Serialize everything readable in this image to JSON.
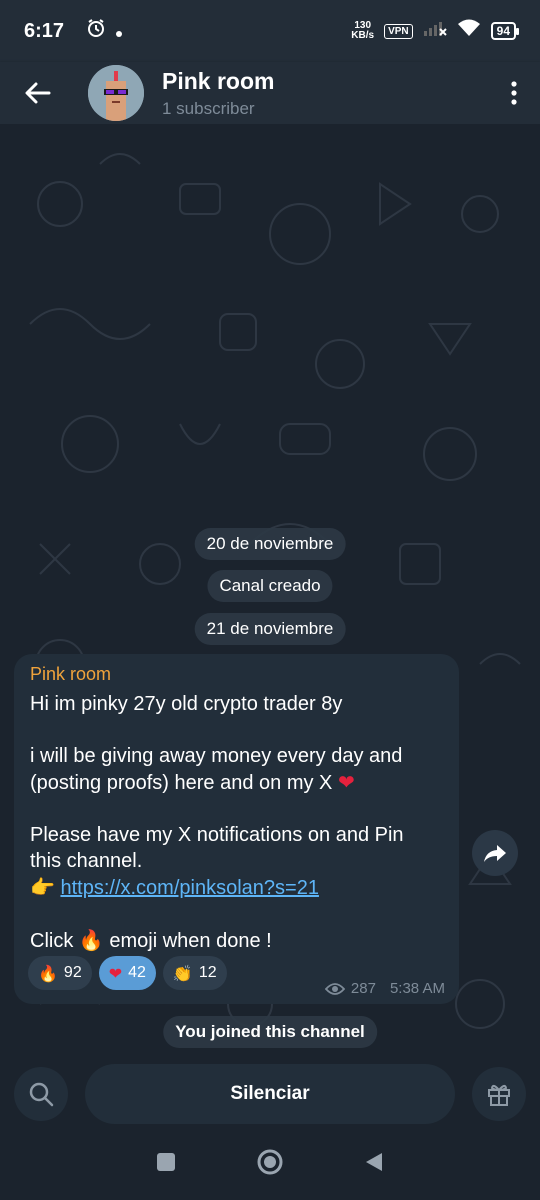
{
  "status_bar": {
    "time": "6:17",
    "net_speed_value": "130",
    "net_speed_unit": "KB/s",
    "vpn": "VPN",
    "battery": "94"
  },
  "header": {
    "title": "Pink room",
    "subtitle": "1 subscriber"
  },
  "chat": {
    "dates": [
      "20 de noviembre",
      "Canal creado",
      "21 de noviembre"
    ],
    "message": {
      "author": "Pink room",
      "line1": "Hi im pinky 27y old crypto trader 8y",
      "line2a": "i will be giving away money every day and",
      "line2b": "(posting proofs) here and on my X",
      "line3a": "Please have my X notifications on and Pin",
      "line3b": "this channel.",
      "link": "https://x.com/pinksolan?s=21",
      "line4a": "Click",
      "line4b": "emoji when done !",
      "reactions": [
        {
          "emoji": "🔥",
          "count": "92",
          "active": false
        },
        {
          "emoji": "❤",
          "count": "42",
          "active": true
        },
        {
          "emoji": "👏",
          "count": "12",
          "active": false
        }
      ],
      "views": "287",
      "time": "5:38 AM"
    },
    "joined_notice": "You joined this channel"
  },
  "bottom_bar": {
    "mute_label": "Silenciar"
  },
  "colors": {
    "background": "#1b232d",
    "header": "#232d38",
    "bubble": "#222e3a",
    "author": "#f0a33c",
    "link": "#5eb5f7",
    "active_reaction": "#5a9cd6"
  }
}
